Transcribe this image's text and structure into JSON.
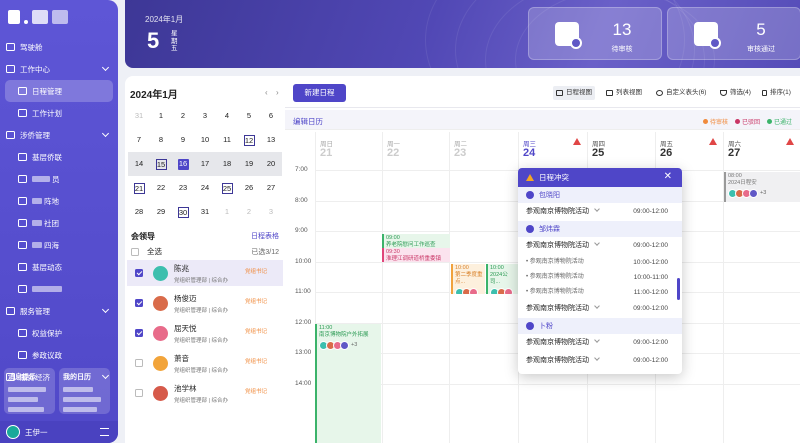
{
  "sidebar": {
    "items": [
      {
        "label": "驾驶舱",
        "type": "top"
      },
      {
        "label": "工作中心",
        "type": "group"
      },
      {
        "label": "日程管理",
        "type": "sub",
        "active": true
      },
      {
        "label": "工作计划",
        "type": "sub"
      },
      {
        "label": "涉侨管理",
        "type": "group"
      },
      {
        "label": "基层侨联",
        "type": "sub"
      },
      {
        "label": "员",
        "type": "sub",
        "blurred": 18
      },
      {
        "label": "阵地",
        "type": "sub",
        "blurred": 10
      },
      {
        "label": "社团",
        "type": "sub",
        "blurred": 10
      },
      {
        "label": "四海",
        "type": "sub",
        "blurred": 10
      },
      {
        "label": "基层动态",
        "type": "sub"
      },
      {
        "label": "",
        "type": "sub",
        "blurred": 30
      },
      {
        "label": "服务管理",
        "type": "group"
      },
      {
        "label": "权益保护",
        "type": "sub"
      },
      {
        "label": "参政议政",
        "type": "sub"
      },
      {
        "label": "服务经济",
        "type": "group"
      }
    ],
    "msg_title": "消息提示",
    "calendar_title": "我的日历",
    "user_name": "王伊一"
  },
  "banner": {
    "year_month": "2024年1月",
    "day": "5",
    "weekday": "星期五",
    "pending_count": "13",
    "pending_label": "待审核",
    "approved_count": "5",
    "approved_label": "审核通过"
  },
  "calendar": {
    "title": "2024年1月",
    "prev": "‹",
    "next": "›",
    "rows": [
      {
        "shade": false,
        "cells": [
          {
            "t": "31",
            "dim": true
          },
          {
            "t": "1"
          },
          {
            "t": "2"
          },
          {
            "t": "3"
          },
          {
            "t": "4"
          },
          {
            "t": "5"
          },
          {
            "t": "6"
          }
        ]
      },
      {
        "shade": false,
        "cells": [
          {
            "t": "7"
          },
          {
            "t": "8"
          },
          {
            "t": "9"
          },
          {
            "t": "10"
          },
          {
            "t": "11"
          },
          {
            "t": "12",
            "box": true
          },
          {
            "t": "13"
          }
        ]
      },
      {
        "shade": true,
        "cells": [
          {
            "t": "14"
          },
          {
            "t": "15",
            "box": true
          },
          {
            "t": "16",
            "today": true
          },
          {
            "t": "17"
          },
          {
            "t": "18"
          },
          {
            "t": "19"
          },
          {
            "t": "20"
          }
        ]
      },
      {
        "shade": false,
        "cells": [
          {
            "t": "21",
            "box": true
          },
          {
            "t": "22"
          },
          {
            "t": "23"
          },
          {
            "t": "24"
          },
          {
            "t": "25",
            "box": true
          },
          {
            "t": "26"
          },
          {
            "t": "27"
          }
        ]
      },
      {
        "shade": false,
        "cells": [
          {
            "t": "28"
          },
          {
            "t": "29"
          },
          {
            "t": "30",
            "box": true
          },
          {
            "t": "31"
          },
          {
            "t": "1",
            "dim": true
          },
          {
            "t": "2",
            "dim": true
          },
          {
            "t": "3",
            "dim": true
          }
        ]
      }
    ]
  },
  "leaders": {
    "title": "会领导",
    "link": "日程表格",
    "select_all": "全选",
    "count": "已选3/12",
    "list": [
      {
        "name": "陈兆",
        "dept": "党组织管理部 | 综合办",
        "tag": "党组书记",
        "checked": true,
        "selected": true,
        "color": "#3cbfae"
      },
      {
        "name": "杨俊迈",
        "dept": "党组织管理部 | 综合办",
        "tag": "党组书记",
        "checked": true,
        "color": "#d96b4a"
      },
      {
        "name": "屈天悦",
        "dept": "党组织管理部 | 综合办",
        "tag": "党组书记",
        "checked": true,
        "color": "#e86b8a"
      },
      {
        "name": "萧音",
        "dept": "党组织管理部 | 综合办",
        "tag": "党组书记",
        "checked": false,
        "color": "#f2a43a"
      },
      {
        "name": "池学林",
        "dept": "党组织管理部 | 综合办",
        "tag": "党组书记",
        "checked": false,
        "color": "#d65a4a"
      }
    ]
  },
  "toolbar": {
    "new_label": "新建日程",
    "calendar_view": "日程视图",
    "list_view": "列表视图",
    "custom_header": "自定义表头(6)",
    "filter": "筛选(4)",
    "sort": "排序(1)"
  },
  "subbar": {
    "edit_label": "编辑日历",
    "legend": [
      {
        "label": "待审核",
        "color": "#f08a3c"
      },
      {
        "label": "已驳回",
        "color": "#c93565"
      },
      {
        "label": "已通过",
        "color": "#3bb36a"
      }
    ]
  },
  "days": [
    {
      "wd": "周日",
      "dn": "21"
    },
    {
      "wd": "周一",
      "dn": "22"
    },
    {
      "wd": "周二",
      "dn": "23"
    },
    {
      "wd": "周三",
      "dn": "24",
      "active": true,
      "warn": true
    },
    {
      "wd": "周四",
      "dn": "25",
      "dark": true
    },
    {
      "wd": "周五",
      "dn": "26",
      "dark": true,
      "warn": true
    },
    {
      "wd": "周六",
      "dn": "27",
      "dark": true,
      "warn": true
    }
  ],
  "times": [
    "7:00",
    "8:00",
    "9:00",
    "10:00",
    "11:00",
    "12:00",
    "13:00",
    "14:00"
  ],
  "events": [
    {
      "time": "09:00",
      "title": "养老院慰问工作巡查",
      "style": "g"
    },
    {
      "time": "09:30",
      "title": "淮理江调研道桥重委镇",
      "style": "p"
    },
    {
      "time": "10:00",
      "title": "第二季度重点...",
      "style": "o"
    },
    {
      "time": "10:00",
      "title": "2024公司...",
      "style": "g"
    },
    {
      "time": "08:00",
      "title": "2024日程安",
      "style": "gray",
      "more": "+3"
    },
    {
      "time": "11:00",
      "title": "南京博物院户外拓展",
      "style": "g",
      "more": "+3"
    }
  ],
  "popup": {
    "title": "日程冲突",
    "close": "✕",
    "groups": [
      {
        "person": "包晓阳",
        "rows": [
          {
            "title": "参观南京博物院活动",
            "time": "09:00-12:00",
            "chev": true
          }
        ],
        "subs": []
      },
      {
        "person": "邹炜霖",
        "rows": [
          {
            "title": "参观南京博物院活动",
            "time": "09:00-12:00",
            "chev": true
          }
        ],
        "subs": [
          {
            "title": "参观南京博物院活动",
            "time": "10:00-12:00"
          },
          {
            "title": "参观南京博物院活动",
            "time": "10:00-11:00"
          },
          {
            "title": "参观南京博物院活动",
            "time": "11:00-12:00"
          }
        ],
        "rows2": [
          {
            "title": "参观南京博物院活动",
            "time": "09:00-12:00",
            "chev": true
          }
        ]
      },
      {
        "person": "卜粉",
        "rows": [
          {
            "title": "参观南京博物院活动",
            "time": "09:00-12:00",
            "chev": true
          },
          {
            "title": "参观南京博物院活动",
            "time": "09:00-12:00",
            "chev": true
          }
        ],
        "subs": []
      }
    ]
  }
}
